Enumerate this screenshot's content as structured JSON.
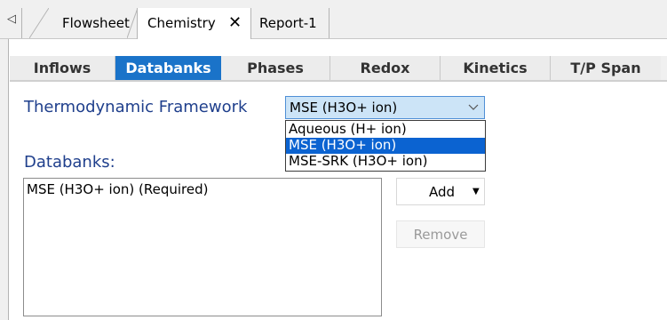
{
  "doc_tabs": {
    "scroll_glyph": "◁",
    "flowsheet": "Flowsheet",
    "chemistry": "Chemistry",
    "report": "Report-1",
    "close_glyph": "✕"
  },
  "section_tabs": [
    "Inflows",
    "Databanks",
    "Phases",
    "Redox",
    "Kinetics",
    "T/P Span"
  ],
  "active_section": "Databanks",
  "framework": {
    "label": "Thermodynamic Framework",
    "value": "MSE (H3O+ ion)",
    "options": [
      "Aqueous (H+ ion)",
      "MSE (H3O+ ion)",
      "MSE-SRK (H3O+ ion)"
    ],
    "highlighted": "MSE (H3O+ ion)"
  },
  "databanks": {
    "label": "Databanks:",
    "items": [
      "MSE (H3O+ ion) (Required)"
    ]
  },
  "buttons": {
    "add": "Add",
    "remove": "Remove"
  },
  "colors": {
    "accent_blue": "#1a73c9",
    "heading_blue": "#1f3f8c",
    "selection_blue": "#0b63d1"
  }
}
